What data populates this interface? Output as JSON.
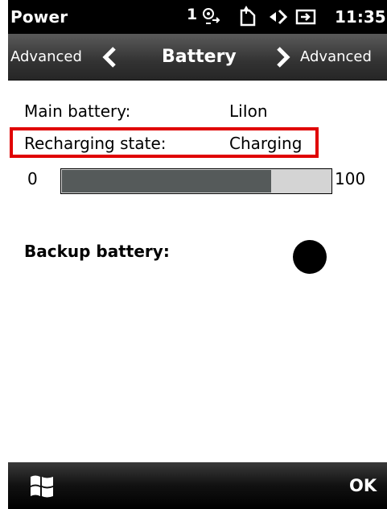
{
  "status": {
    "app_title": "Power",
    "signal_bars": "1",
    "time": "11:35",
    "icons": [
      "network-sync-icon",
      "sim-icon",
      "speaker-icon",
      "charging-icon"
    ]
  },
  "nav": {
    "prev_label": "Advanced",
    "title": "Battery",
    "next_label": "Advanced"
  },
  "battery": {
    "main_label": "Main battery:",
    "main_value": "LiIon",
    "recharge_label": "Recharging state:",
    "recharge_value": "Charging",
    "min_label": "0",
    "max_label": "100",
    "level_fraction": 0.78,
    "backup_label": "Backup battery:"
  },
  "bottom": {
    "start_icon": "windows-start-icon",
    "ok_label": "OK"
  },
  "colors": {
    "highlight": "#e00000",
    "progress_fill": "#555a5a",
    "progress_track": "#d4d4d4"
  }
}
